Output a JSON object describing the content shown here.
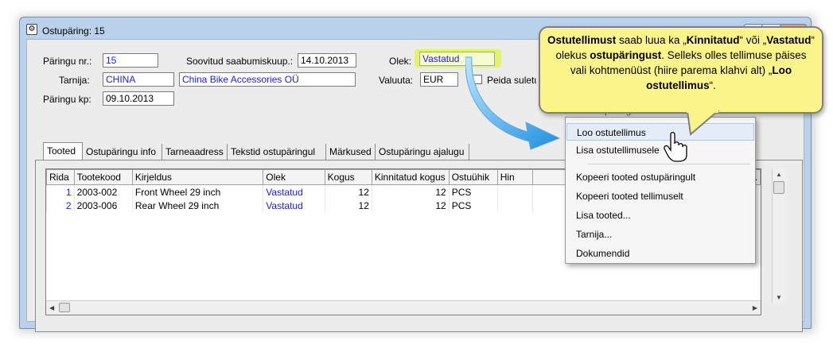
{
  "window": {
    "title": "Ostupäring: 15",
    "buttons": {
      "minimize": "—",
      "maximize": "□",
      "close": "✕"
    }
  },
  "header": {
    "paringu_nr_label": "Päringu nr.:",
    "paringu_nr_value": "15",
    "soovitud_label": "Soovitud saabumiskuup.:",
    "soovitud_value": "14.10.2013",
    "olek_label": "Olek:",
    "olek_value": "Vastatud",
    "tarnija_label": "Tarnija:",
    "tarnija_code": "CHINA",
    "tarnija_name": "China Bike Accessories OÜ",
    "valuuta_label": "Valuuta:",
    "valuuta_value": "EUR",
    "peida_label": "Peida suletu",
    "paringu_kp_label": "Päringu kp:",
    "paringu_kp_value": "09.10.2013"
  },
  "tabs": [
    "Tooted",
    "Ostupäringu info",
    "Tarneaadress",
    "Tekstid ostupäringul",
    "Märkused",
    "Ostupäringu ajalugu"
  ],
  "table": {
    "columns": [
      "Rida",
      "Tootekood",
      "Kirjeldus",
      "Olek",
      "Kogus",
      "Kinnitatud kogus",
      "Ostuühik",
      "Hin"
    ],
    "extra_col": "b.",
    "rows": [
      {
        "rida": "1",
        "tootekood": "2003-002",
        "kirjeldus": "Front Wheel 29 inch",
        "olek": "Vastatud",
        "kogus": "12",
        "kinnitatud": "12",
        "ostuyhik": "PCS"
      },
      {
        "rida": "2",
        "tootekood": "2003-006",
        "kirjeldus": "Rear Wheel 29 inch",
        "olek": "Vastatud",
        "kogus": "12",
        "kinnitatud": "12",
        "ostuyhik": "PCS"
      }
    ]
  },
  "context_menu": {
    "items": [
      "Loo ostutellimus",
      "Lisa ostutellimusele",
      "Kopeeri tooted ostupäringult",
      "Kopeeri tooted tellimuselt",
      "Lisa tooted...",
      "Tarnija...",
      "Dokumendid"
    ],
    "partial_top": "... ostupäring"
  },
  "callout": {
    "t1": "Ostutellimust",
    "t2": " saab luua ka „",
    "t3": "Kinnitatud",
    "t4": "“ või „",
    "t5": "Vastatud",
    "t6": "“ olekus ",
    "t7": "ostupäringust",
    "t8": ". Selleks olles tellimuse päises vali kohtmenüüst (hiire parema klahvi alt) „",
    "t9": "Loo ostutellimus",
    "t10": "“."
  },
  "colors": {
    "accent_blue": "#1a1aff",
    "callout_bg": "#fbf48b",
    "highlight": "#e6f36a"
  }
}
